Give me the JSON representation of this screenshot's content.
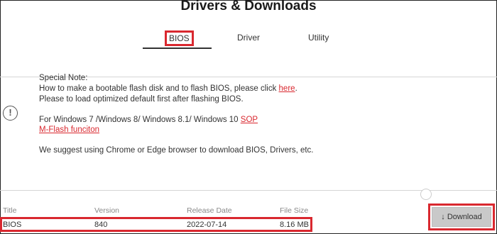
{
  "page": {
    "title": "Drivers & Downloads"
  },
  "tabs": [
    {
      "label": "BIOS",
      "active": true
    },
    {
      "label": "Driver"
    },
    {
      "label": "Utility"
    }
  ],
  "notice": {
    "icon": "exclamation-circle-icon",
    "special_note": "Special Note:",
    "line1_text": "How to make a bootable flash disk and to flash BIOS, please click",
    "line1_link": "here",
    "line1_end": ".",
    "line2": "Please to load optimized default first after flashing BIOS.",
    "line3_text": "For Windows 7 /Windows 8/ Windows 8.1/ Windows 10",
    "line3_link": "SOP",
    "line4_link": "M-Flash funciton",
    "line5": "We suggest using Chrome or Edge browser to download BIOS, Drivers, etc."
  },
  "table": {
    "headers": [
      "Title",
      "Version",
      "Release Date",
      "File Size"
    ],
    "rows": [
      [
        "BIOS",
        "840",
        "2022-07-14",
        "8.16 MB"
      ]
    ]
  },
  "download": {
    "label": "Download",
    "icon": "download-arrow-icon"
  },
  "colors": {
    "accent_red": "#d9282f",
    "button_gray": "#c9c9c9"
  }
}
